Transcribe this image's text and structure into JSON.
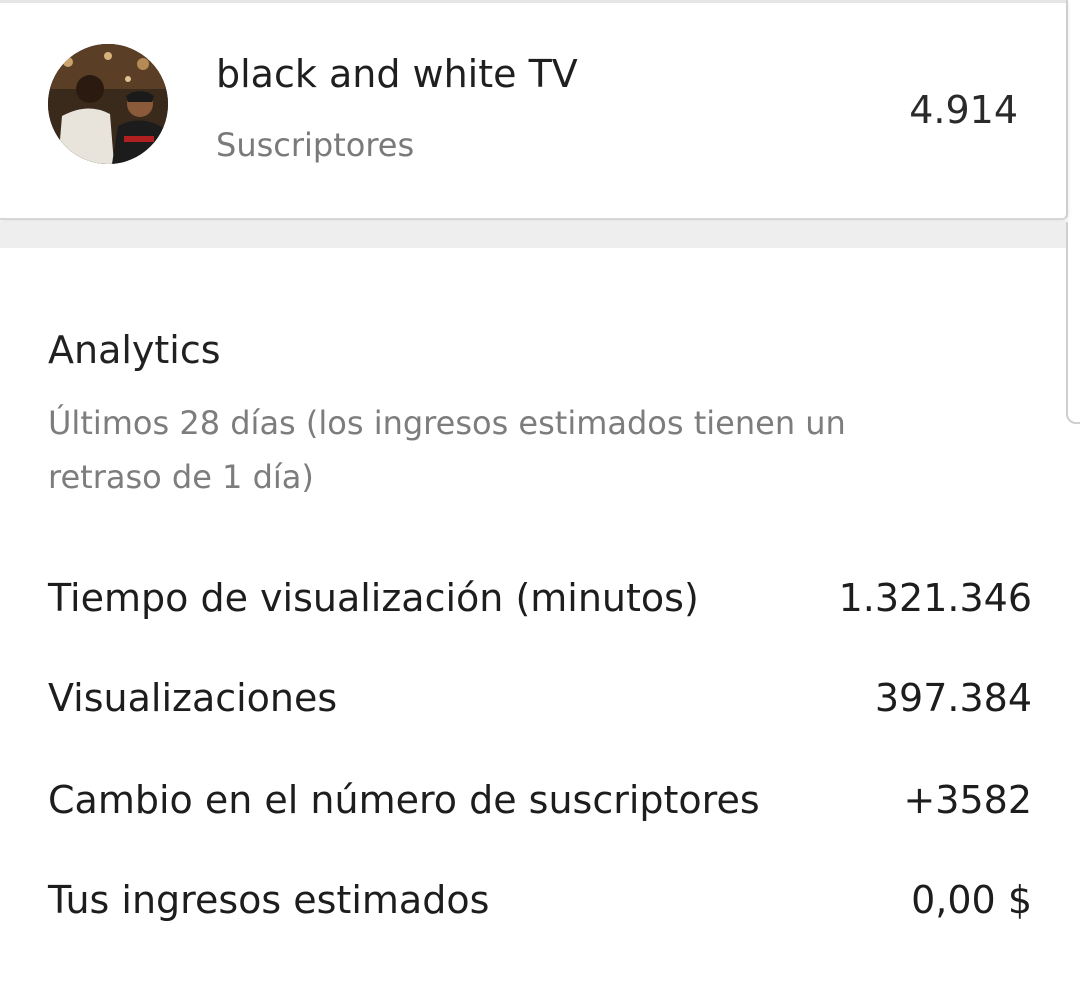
{
  "channel": {
    "name": "black and white TV",
    "subscribers_label": "Suscriptores",
    "subscribers_count": "4.914",
    "avatar": "channel-avatar-photo"
  },
  "analytics": {
    "title": "Analytics",
    "subtitle": "Últimos 28 días (los ingresos estimados tienen un retraso de 1 día)",
    "metrics": [
      {
        "label": "Tiempo de visualización (minutos)",
        "value": "1.321.346"
      },
      {
        "label": "Visualizaciones",
        "value": "397.384"
      },
      {
        "label": "Cambio en el número de suscriptores",
        "value": "+3582"
      },
      {
        "label": "Tus ingresos estimados",
        "value": "0,00 $"
      }
    ]
  }
}
